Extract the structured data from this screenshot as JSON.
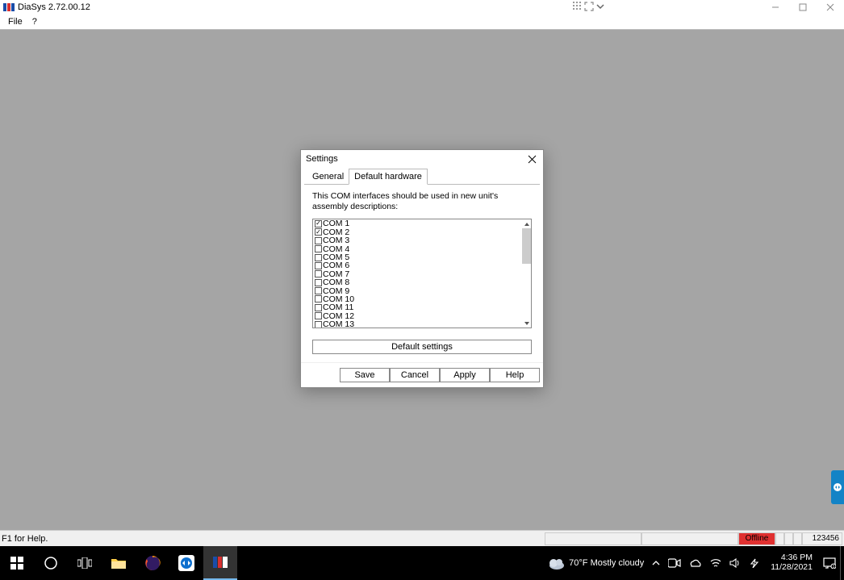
{
  "window": {
    "title": "DiaSys 2.72.00.12",
    "menu": {
      "file": "File",
      "help": "?"
    }
  },
  "dialog": {
    "title": "Settings",
    "tabs": {
      "general": "General",
      "default_hardware": "Default hardware"
    },
    "description": "This COM interfaces should be used in new unit's assembly descriptions:",
    "com_ports": [
      {
        "label": "COM 1",
        "checked": true
      },
      {
        "label": "COM 2",
        "checked": true
      },
      {
        "label": "COM 3",
        "checked": false
      },
      {
        "label": "COM 4",
        "checked": false
      },
      {
        "label": "COM 5",
        "checked": false
      },
      {
        "label": "COM 6",
        "checked": false
      },
      {
        "label": "COM 7",
        "checked": false
      },
      {
        "label": "COM 8",
        "checked": false
      },
      {
        "label": "COM 9",
        "checked": false
      },
      {
        "label": "COM 10",
        "checked": false
      },
      {
        "label": "COM 11",
        "checked": false
      },
      {
        "label": "COM 12",
        "checked": false
      },
      {
        "label": "COM 13",
        "checked": false
      }
    ],
    "default_button": "Default settings",
    "footer": {
      "save": "Save",
      "cancel": "Cancel",
      "apply": "Apply",
      "help": "Help"
    }
  },
  "statusbar": {
    "help": "F1 for Help.",
    "offline": "Offline",
    "counter": "123456"
  },
  "taskbar": {
    "weather_temp": "70°F",
    "weather_desc": "Mostly cloudy",
    "time": "4:36 PM",
    "date": "11/28/2021"
  }
}
